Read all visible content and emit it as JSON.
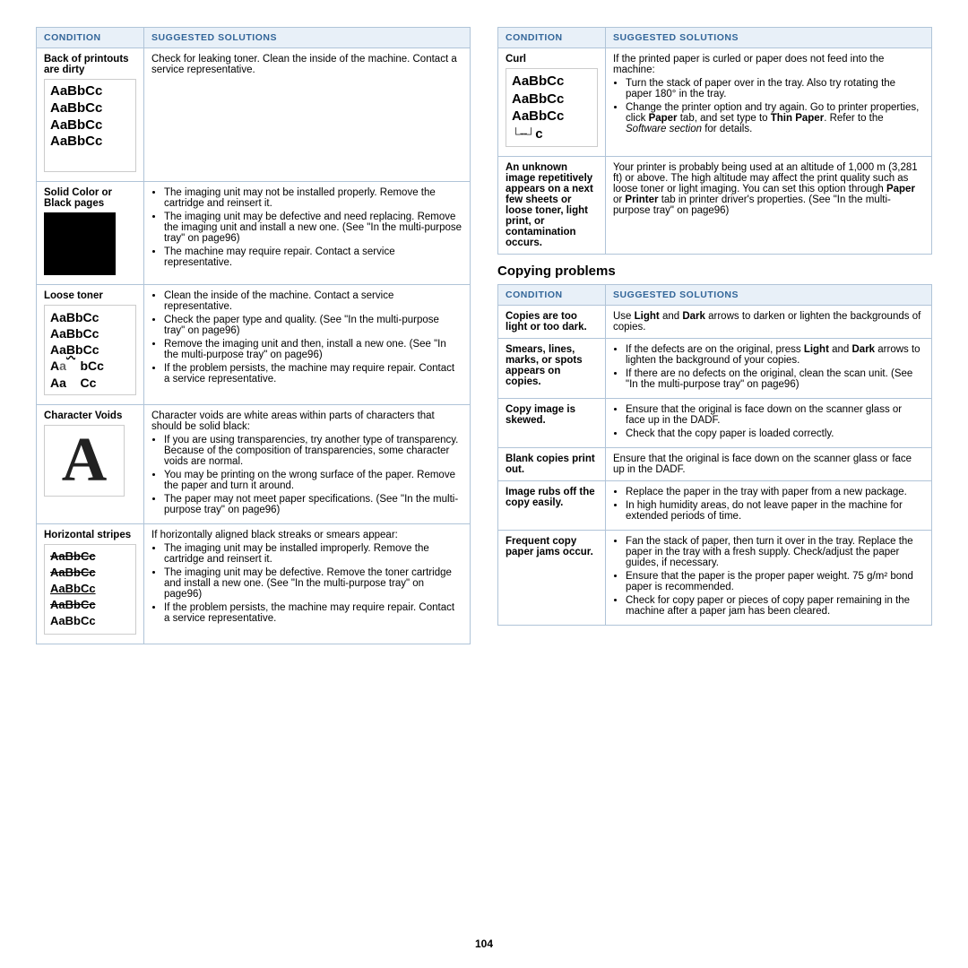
{
  "page": {
    "number": "104",
    "left_column": {
      "table": {
        "headers": [
          "Condition",
          "Suggested Solutions"
        ],
        "rows": [
          {
            "condition_label": "Back of printouts are dirty",
            "condition_image_type": "sample-text",
            "solution": "Check for leaking toner. Clean the inside of the machine. Contact a service representative."
          },
          {
            "condition_label": "Solid Color or Black pages",
            "condition_image_type": "black-block",
            "solution_bullets": [
              "The imaging unit may not be installed properly. Remove the cartridge and reinsert it.",
              "The imaging unit may be defective and need replacing. Remove the imaging unit and install a new one. (See \"In the multi-purpose tray\" on page96)",
              "The machine may require repair. Contact a service representative."
            ]
          },
          {
            "condition_label": "Loose toner",
            "condition_image_type": "loose-toner",
            "solution_bullets": [
              "Clean the inside of the machine. Contact a service representative.",
              "Check the paper type and quality. (See \"In the multi-purpose tray\" on page96)",
              "Remove the imaging unit and then, install a new one. (See \"In the multi-purpose tray\" on page96)",
              "If the problem persists, the machine may require repair. Contact a service representative."
            ]
          },
          {
            "condition_label": "Character Voids",
            "condition_image_type": "char-voids",
            "solution_text": "Character voids are white areas within parts of characters that should be solid black:",
            "solution_bullets": [
              "If you are using transparencies, try another type of transparency. Because of the composition of transparencies, some character voids are normal.",
              "You may be printing on the wrong surface of the paper. Remove the paper and turn it around.",
              "The paper may not meet paper specifications. (See \"In the multi-purpose tray\" on page96)"
            ]
          },
          {
            "condition_label": "Horizontal stripes",
            "condition_image_type": "horiz-stripes",
            "solution_text": "If horizontally aligned black streaks or smears appear:",
            "solution_bullets": [
              "The imaging unit may be installed improperly. Remove the cartridge and reinsert it.",
              "The imaging unit may be defective. Remove the toner cartridge and install a new one. (See \"In the multi-purpose tray\" on page96)",
              "If the problem persists, the machine may require repair. Contact a service representative."
            ]
          }
        ]
      }
    },
    "right_column": {
      "top_table": {
        "headers": [
          "Condition",
          "Suggested Solutions"
        ],
        "rows": [
          {
            "condition_label": "Curl",
            "condition_image_type": "curl",
            "solution_intro": "If the printed paper is curled or paper does not feed into the machine:",
            "solution_bullets": [
              "Turn the stack of paper over in the tray. Also try rotating the paper 180° in the tray.",
              "Change the printer option and try again. Go to printer properties, click Paper tab, and set type to Thin Paper. Refer to the Software section for details."
            ]
          },
          {
            "condition_label": "An unknown image repetitively appears on a next few sheets or loose toner, light print, or contamination occurs.",
            "condition_image_type": null,
            "solution_text": "Your printer is probably being used at an altitude of 1,000 m (3,281 ft) or above. The high altitude may affect the print quality such as loose toner or light imaging. You can set this option through Paper or Printer tab in printer driver's properties. (See \"In the multi-purpose tray\" on page96)"
          }
        ]
      },
      "copying_section": {
        "title": "Copying problems",
        "table": {
          "headers": [
            "Condition",
            "Suggested Solutions"
          ],
          "rows": [
            {
              "condition_label": "Copies are too light or too dark.",
              "solution_text": "Use Light and Dark arrows to darken or lighten the backgrounds of copies."
            },
            {
              "condition_label": "Smears, lines, marks, or spots appears on copies.",
              "solution_bullets": [
                "If the defects are on the original, press Light and Dark arrows to lighten the background of your copies.",
                "If there are no defects on the original, clean the scan unit. (See \"In the multi-purpose tray\" on page96)"
              ]
            },
            {
              "condition_label": "Copy image is skewed.",
              "solution_bullets": [
                "Ensure that the original is face down on the scanner glass or face up in the DADF.",
                "Check that the copy paper is loaded correctly."
              ]
            },
            {
              "condition_label": "Blank copies print out.",
              "solution_text": "Ensure that the original is face down on the scanner glass or face up in the DADF."
            },
            {
              "condition_label": "Image rubs off the copy easily.",
              "solution_bullets": [
                "Replace the paper in the tray with paper from a new package.",
                "In high humidity areas, do not leave paper in the machine for extended periods of time."
              ]
            },
            {
              "condition_label": "Frequent copy paper jams occur.",
              "solution_bullets": [
                "Fan the stack of paper, then turn it over in the tray. Replace the paper in the tray with a fresh supply. Check/adjust the paper guides, if necessary.",
                "Ensure that the paper is the proper paper weight. 75 g/m² bond paper is recommended.",
                "Check for copy paper or pieces of copy paper remaining in the machine after a paper jam has been cleared."
              ]
            }
          ]
        }
      }
    }
  }
}
